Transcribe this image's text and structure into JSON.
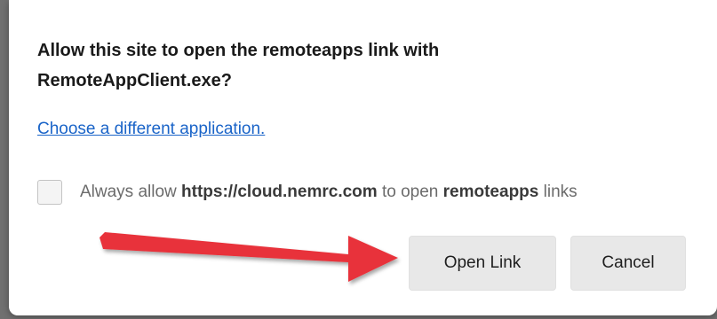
{
  "dialog": {
    "title_line1": "Allow this site to open the remoteapps link with",
    "title_line2": "RemoteAppClient.exe?",
    "choose_link": "Choose a different application.",
    "checkbox": {
      "checked": false,
      "text_prefix": "Always allow ",
      "site": "https://cloud.nemrc.com",
      "text_middle": " to open ",
      "protocol": "remoteapps",
      "text_suffix": " links"
    },
    "open_button": "Open Link",
    "cancel_button": "Cancel"
  },
  "annotation": {
    "arrow_color": "#e8333a",
    "arrow_icon": "red-arrow-icon"
  },
  "colors": {
    "link": "#1a64c8",
    "button_bg": "#e8e8e8",
    "backdrop": "#707070"
  }
}
